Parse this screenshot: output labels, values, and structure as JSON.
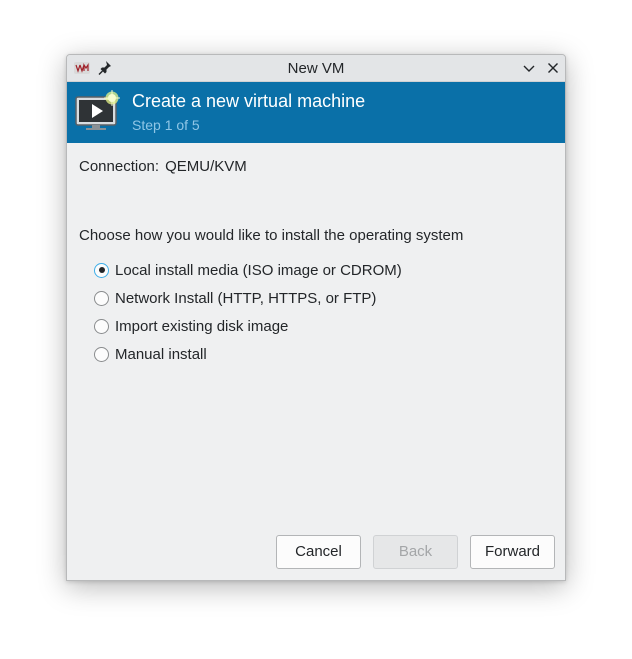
{
  "window": {
    "title": "New VM"
  },
  "banner": {
    "title": "Create a new virtual machine",
    "step": "Step 1 of 5"
  },
  "connection": {
    "label": "Connection:",
    "value": "QEMU/KVM"
  },
  "install": {
    "prompt": "Choose how you would like to install the operating system",
    "options": [
      {
        "label": "Local install media (ISO image or CDROM)",
        "selected": true
      },
      {
        "label": "Network Install (HTTP, HTTPS, or FTP)",
        "selected": false
      },
      {
        "label": "Import existing disk image",
        "selected": false
      },
      {
        "label": "Manual install",
        "selected": false
      }
    ]
  },
  "buttons": {
    "cancel": "Cancel",
    "back": "Back",
    "forward": "Forward",
    "back_enabled": false
  },
  "colors": {
    "banner_bg": "#0a70a8",
    "step_text": "#8fc6e6",
    "window_bg": "#eff0f1",
    "radio_focus": "#3daee9"
  },
  "icons": {
    "app": "virt-manager-icon",
    "pin": "pin-icon",
    "minimize": "chevron-down-icon",
    "close": "close-icon",
    "banner": "new-vm-icon"
  }
}
